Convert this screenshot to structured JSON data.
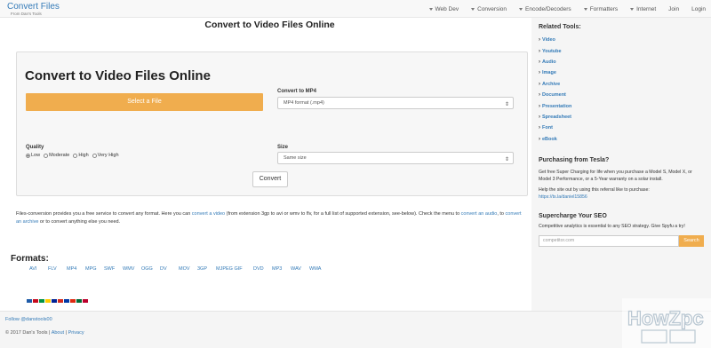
{
  "header": {
    "brand_title": "Convert Files",
    "brand_sub": "From Dan's Tools",
    "nav": [
      "Web Dev",
      "Conversion",
      "Encode/Decoders",
      "Formatters",
      "Internet",
      "Join",
      "Login"
    ]
  },
  "main": {
    "page_title": "Convert to Video Files Online",
    "panel_title": "Convert to Video Files Online",
    "select_file": "Select a File",
    "convert_to_label": "Convert to MP4",
    "convert_to_value": "MP4 format (.mp4)",
    "quality_label": "Quality",
    "quality_options": [
      "Low",
      "Moderate",
      "High",
      "Very High"
    ],
    "quality_selected": "Low",
    "size_label": "Size",
    "size_value": "Same size",
    "convert_button": "Convert",
    "desc": {
      "p1": "Files-conversion provides you a free service to convert any format. Here you can ",
      "link1": "convert a video",
      "p2": " (from extension 3gp to avi or wmv to flv, for a full list of supported extension, see-below). Check the menu to ",
      "link2": "convert an audio",
      "p3": ", to ",
      "link3": "convert an archive",
      "p4": " or to convert anything else you need."
    },
    "formats_heading": "Formats:",
    "formats": [
      "AVI",
      "FLV",
      "MP4",
      "MPG",
      "SWF",
      "WMV",
      "OGG",
      "DV",
      "MOV",
      "3GP",
      "MJPEG GIF",
      "DVD",
      "MP3",
      "WAV",
      "WMA"
    ]
  },
  "flags": [
    "#1e5ba8",
    "#c60b1e",
    "#009246",
    "#ffcc00",
    "#002395",
    "#d52b1e",
    "#0039a6",
    "#de2910",
    "#006c35",
    "#bc002d"
  ],
  "sidebar": {
    "related_heading": "Related Tools:",
    "tools": [
      "Video",
      "Youtube",
      "Audio",
      "Image",
      "Archive",
      "Document",
      "Presentation",
      "Spreadsheet",
      "Font",
      "eBook"
    ],
    "tesla_heading": "Purchasing from Tesla?",
    "tesla_p1": "Get free Super Charging for life when you purchase a Model S, Model X, or Model 3 Performance, or a 5-Year warranty on a solar install.",
    "tesla_p2": "Help the site out by using this referral like to purchase:",
    "tesla_link": "https://ts.la/daniel15856",
    "seo_heading": "Supercharge Your SEO",
    "seo_p": "Competitive analytics is essential to any SEO strategy. Give Spyfu a try!",
    "seo_placeholder": "competitor.com",
    "seo_button": "Search"
  },
  "footer": {
    "follow": "Follow @danstools00",
    "copyright": "© 2017 Dan's Tools | ",
    "about": "About",
    "sep": " | ",
    "privacy": "Privacy"
  },
  "watermark": "HowZpc",
  "colors": {
    "accent": "#f0ad4e",
    "link": "#337ab7"
  }
}
